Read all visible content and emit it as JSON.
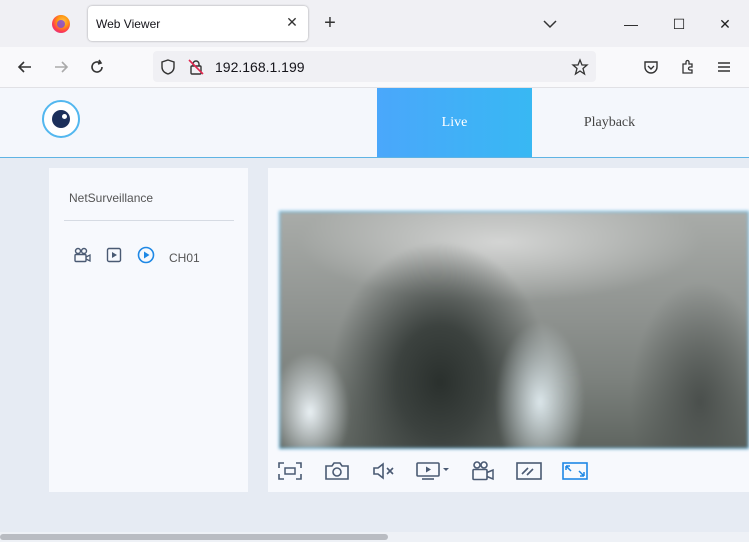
{
  "browser": {
    "tab_title": "Web Viewer",
    "tab_close": "✕",
    "new_tab": "+",
    "url": "192.168.1.199"
  },
  "window": {
    "minimize": "—",
    "maximize": "☐",
    "close": "✕"
  },
  "app": {
    "nav": {
      "live": "Live",
      "playback": "Playback"
    },
    "sidebar": {
      "device_name": "NetSurveillance",
      "channel_label": "CH01"
    }
  },
  "colors": {
    "accent": "#4aa7fb",
    "active_icon": "#1e88e5",
    "icon": "#4a5a73"
  },
  "icons": {
    "sidebar": [
      "camera-record-icon",
      "playback-icon",
      "live-play-icon"
    ],
    "toolbar": [
      "fit-screen-icon",
      "snapshot-icon",
      "mute-icon",
      "stream-select-icon",
      "record-icon",
      "stretch-icon",
      "fullscreen-icon"
    ]
  }
}
